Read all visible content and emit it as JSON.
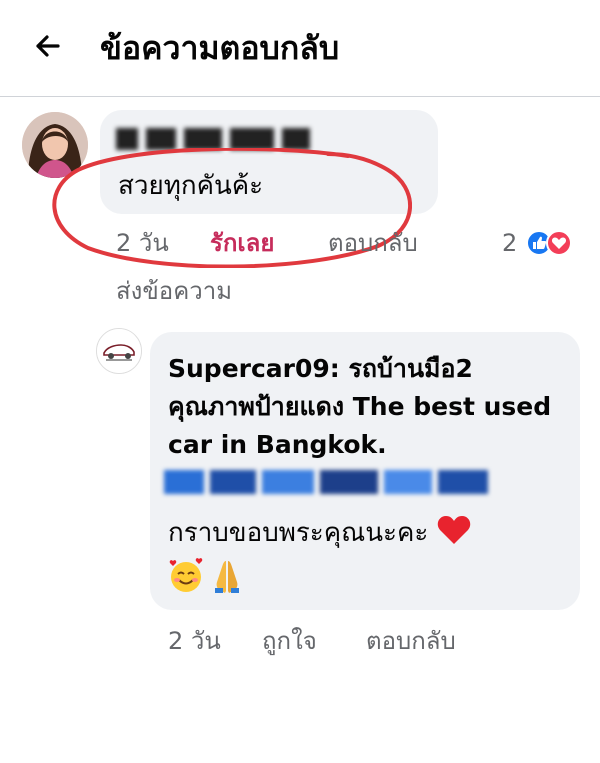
{
  "header": {
    "title": "ข้อความตอบกลับ",
    "back_icon": "arrow-left-icon"
  },
  "comment": {
    "text": "สวยทุกคันค้ะ",
    "time": "2 วัน",
    "reaction_label": "รักเลย",
    "reply_label": "ตอบกลับ",
    "reaction_count": "2",
    "send_message_label": "ส่งข้อความ"
  },
  "reply": {
    "author_text": "Supercar09: รถบ้านมือ2 คุณภาพป้ายแดง The best used car in Bangkok.",
    "thanks_text": "กราบขอบพระคุณนะคะ",
    "time": "2 วัน",
    "like_label": "ถูกใจ",
    "reply_label": "ตอบกลับ"
  },
  "colors": {
    "link_blue": "#1877f2",
    "love_red": "#c62c5b",
    "secondary_text": "#65676b",
    "bubble_bg": "#f0f2f5",
    "annotation_red": "#e0393e"
  }
}
